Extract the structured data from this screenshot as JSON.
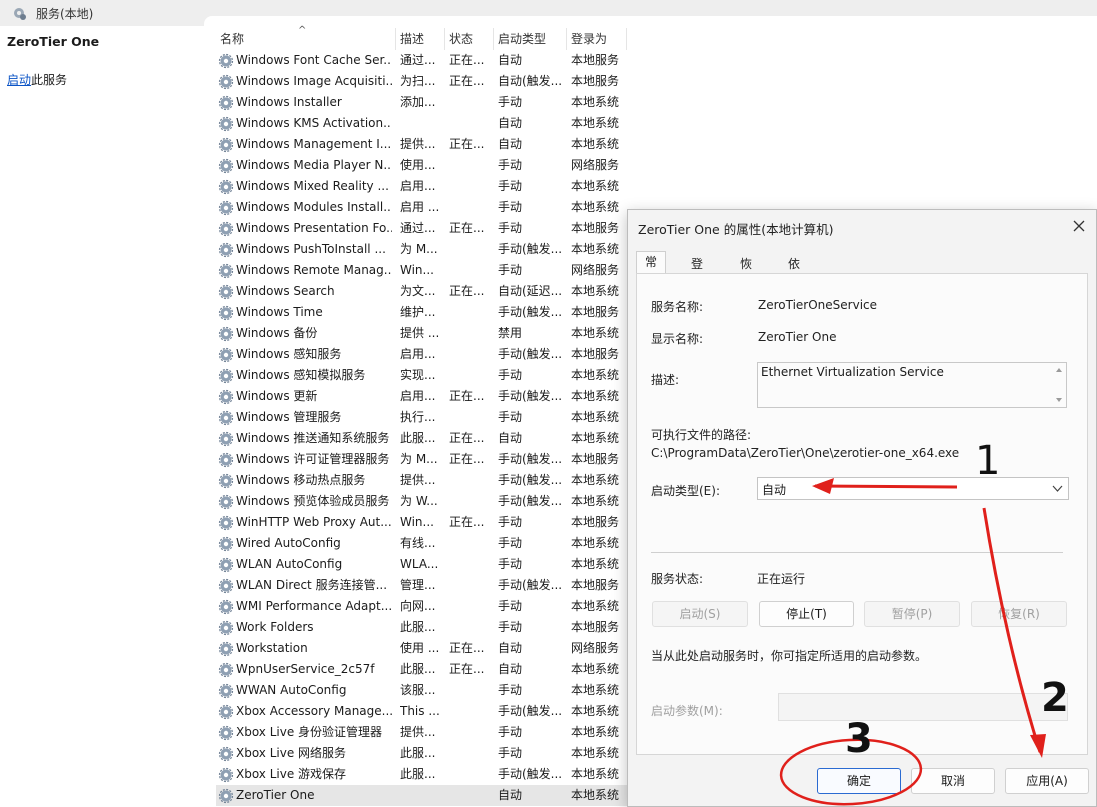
{
  "window": {
    "title": "服务(本地)"
  },
  "left_pane": {
    "service_name": "ZeroTier One",
    "start_link": "启动",
    "start_suffix": "此服务"
  },
  "columns": {
    "name": "名称",
    "description": "描述",
    "status": "状态",
    "startup_type": "启动类型",
    "logon_as": "登录为"
  },
  "services": [
    {
      "name": "Windows Font Cache Ser...",
      "desc": "通过...",
      "status": "正在...",
      "type": "自动",
      "logon": "本地服务"
    },
    {
      "name": "Windows Image Acquisiti...",
      "desc": "为扫...",
      "status": "正在...",
      "type": "自动(触发...",
      "logon": "本地服务"
    },
    {
      "name": "Windows Installer",
      "desc": "添加...",
      "status": "",
      "type": "手动",
      "logon": "本地系统"
    },
    {
      "name": "Windows KMS Activation...",
      "desc": "",
      "status": "",
      "type": "自动",
      "logon": "本地系统"
    },
    {
      "name": "Windows Management I...",
      "desc": "提供...",
      "status": "正在...",
      "type": "自动",
      "logon": "本地系统"
    },
    {
      "name": "Windows Media Player N...",
      "desc": "使用...",
      "status": "",
      "type": "手动",
      "logon": "网络服务"
    },
    {
      "name": "Windows Mixed Reality ...",
      "desc": "启用...",
      "status": "",
      "type": "手动",
      "logon": "本地系统"
    },
    {
      "name": "Windows Modules Install...",
      "desc": "启用 ...",
      "status": "",
      "type": "手动",
      "logon": "本地系统"
    },
    {
      "name": "Windows Presentation Fo...",
      "desc": "通过...",
      "status": "正在...",
      "type": "手动",
      "logon": "本地服务"
    },
    {
      "name": "Windows PushToInstall ...",
      "desc": "为 M...",
      "status": "",
      "type": "手动(触发...",
      "logon": "本地系统"
    },
    {
      "name": "Windows Remote Manag...",
      "desc": "Win...",
      "status": "",
      "type": "手动",
      "logon": "网络服务"
    },
    {
      "name": "Windows Search",
      "desc": "为文...",
      "status": "正在...",
      "type": "自动(延迟...",
      "logon": "本地系统"
    },
    {
      "name": "Windows Time",
      "desc": "维护...",
      "status": "",
      "type": "手动(触发...",
      "logon": "本地服务"
    },
    {
      "name": "Windows 备份",
      "desc": "提供 ...",
      "status": "",
      "type": "禁用",
      "logon": "本地系统"
    },
    {
      "name": "Windows 感知服务",
      "desc": "启用...",
      "status": "",
      "type": "手动(触发...",
      "logon": "本地服务"
    },
    {
      "name": "Windows 感知模拟服务",
      "desc": "实现...",
      "status": "",
      "type": "手动",
      "logon": "本地系统"
    },
    {
      "name": "Windows 更新",
      "desc": "启用...",
      "status": "正在...",
      "type": "手动(触发...",
      "logon": "本地系统"
    },
    {
      "name": "Windows 管理服务",
      "desc": "执行...",
      "status": "",
      "type": "手动",
      "logon": "本地系统"
    },
    {
      "name": "Windows 推送通知系统服务",
      "desc": "此服...",
      "status": "正在...",
      "type": "自动",
      "logon": "本地系统"
    },
    {
      "name": "Windows 许可证管理器服务",
      "desc": "为 M...",
      "status": "正在...",
      "type": "手动(触发...",
      "logon": "本地服务"
    },
    {
      "name": "Windows 移动热点服务",
      "desc": "提供...",
      "status": "",
      "type": "手动(触发...",
      "logon": "本地系统"
    },
    {
      "name": "Windows 预览体验成员服务",
      "desc": "为 W...",
      "status": "",
      "type": "手动(触发...",
      "logon": "本地系统"
    },
    {
      "name": "WinHTTP Web Proxy Aut...",
      "desc": "Win...",
      "status": "正在...",
      "type": "手动",
      "logon": "本地服务"
    },
    {
      "name": "Wired AutoConfig",
      "desc": "有线...",
      "status": "",
      "type": "手动",
      "logon": "本地系统"
    },
    {
      "name": "WLAN AutoConfig",
      "desc": "WLA...",
      "status": "",
      "type": "手动",
      "logon": "本地系统"
    },
    {
      "name": "WLAN Direct 服务连接管...",
      "desc": "管理...",
      "status": "",
      "type": "手动(触发...",
      "logon": "本地服务"
    },
    {
      "name": "WMI Performance Adapt...",
      "desc": "向网...",
      "status": "",
      "type": "手动",
      "logon": "本地系统"
    },
    {
      "name": "Work Folders",
      "desc": "此服...",
      "status": "",
      "type": "手动",
      "logon": "本地服务"
    },
    {
      "name": "Workstation",
      "desc": "使用 ...",
      "status": "正在...",
      "type": "自动",
      "logon": "网络服务"
    },
    {
      "name": "WpnUserService_2c57f",
      "desc": "此服...",
      "status": "正在...",
      "type": "自动",
      "logon": "本地系统"
    },
    {
      "name": "WWAN AutoConfig",
      "desc": "该服...",
      "status": "",
      "type": "手动",
      "logon": "本地系统"
    },
    {
      "name": "Xbox Accessory Manage...",
      "desc": "This ...",
      "status": "",
      "type": "手动(触发...",
      "logon": "本地系统"
    },
    {
      "name": "Xbox Live 身份验证管理器",
      "desc": "提供...",
      "status": "",
      "type": "手动",
      "logon": "本地系统"
    },
    {
      "name": "Xbox Live 网络服务",
      "desc": "此服...",
      "status": "",
      "type": "手动",
      "logon": "本地系统"
    },
    {
      "name": "Xbox Live 游戏保存",
      "desc": "此服...",
      "status": "",
      "type": "手动(触发...",
      "logon": "本地系统"
    },
    {
      "name": "ZeroTier One",
      "desc": "",
      "status": "",
      "type": "自动",
      "logon": "本地系统",
      "selected": true
    }
  ],
  "dialog": {
    "title": "ZeroTier One 的属性(本地计算机)",
    "tabs": [
      "常规",
      "登录",
      "恢复",
      "依存关系"
    ],
    "service_name_label": "服务名称:",
    "service_name_value": "ZeroTierOneService",
    "display_name_label": "显示名称:",
    "display_name_value": "ZeroTier One",
    "description_label": "描述:",
    "description_value": "Ethernet Virtualization Service",
    "path_label": "可执行文件的路径:",
    "path_value": "C:\\ProgramData\\ZeroTier\\One\\zerotier-one_x64.exe",
    "startup_type_label": "启动类型(E):",
    "startup_type_value": "自动",
    "status_label": "服务状态:",
    "status_value": "正在运行",
    "btn_start": "启动(S)",
    "btn_stop": "停止(T)",
    "btn_pause": "暂停(P)",
    "btn_resume": "恢复(R)",
    "hint": "当从此处启动服务时，你可指定所适用的启动参数。",
    "param_label": "启动参数(M):",
    "btn_ok": "确定",
    "btn_cancel": "取消",
    "btn_apply": "应用(A)"
  },
  "annotations": {
    "num1": "1",
    "num2": "2",
    "num3": "3",
    "color": "#e0201b"
  }
}
